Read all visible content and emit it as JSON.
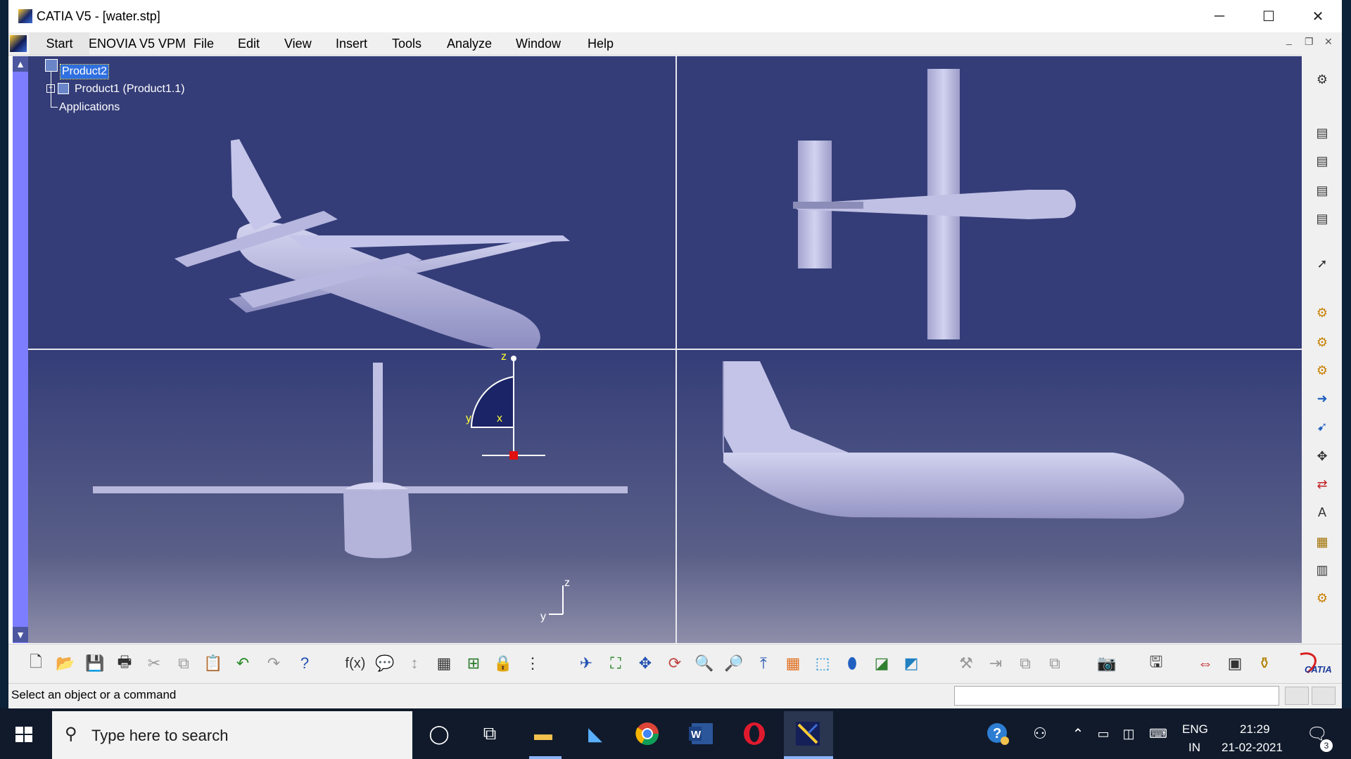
{
  "window": {
    "title": "CATIA V5 - [water.stp]",
    "controls": {
      "minimize": "─",
      "maximize": "☐",
      "close": "✕"
    },
    "doc_controls": {
      "minimize": "_",
      "restore": "❐",
      "close": "✕"
    }
  },
  "menubar": {
    "items": [
      "Start",
      "ENOVIA V5 VPM",
      "File",
      "Edit",
      "View",
      "Insert",
      "Tools",
      "Analyze",
      "Window",
      "Help"
    ]
  },
  "tree": {
    "root": "Product2",
    "child": "Product1 (Product1.1)",
    "applications": "Applications"
  },
  "compass": {
    "z": "z",
    "y": "y",
    "x": "x"
  },
  "axis_triad": {
    "z": "z",
    "y": "y"
  },
  "status": {
    "message": "Select an object or a command"
  },
  "brand": {
    "logo_text": "CATIA"
  },
  "taskbar": {
    "search_placeholder": "Type here to search",
    "language_top": "ENG",
    "language_bottom": "IN",
    "time": "21:29",
    "date": "21-02-2021",
    "notification_count": "3"
  },
  "colors": {
    "viewport_bg": "#343d78",
    "model": "#b4b4dc",
    "selection": "#2f6fe0",
    "compass_fill": "#1a2466",
    "accent_red": "#e01010"
  }
}
